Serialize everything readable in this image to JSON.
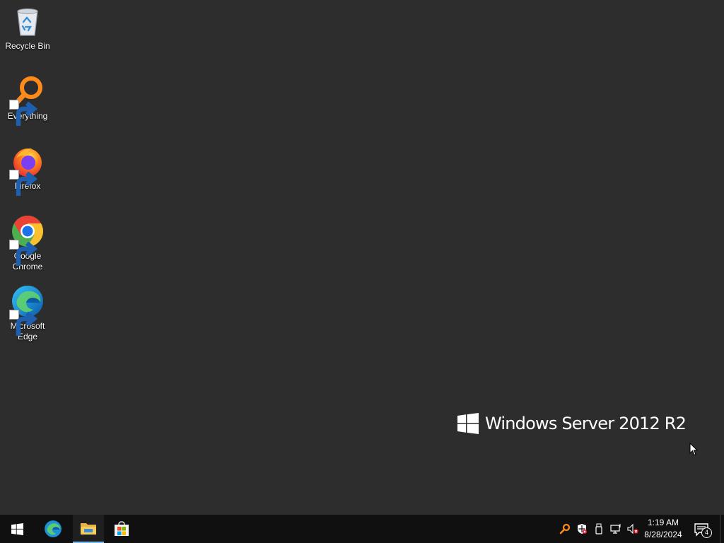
{
  "desktop": {
    "icons": [
      {
        "label": "Recycle Bin",
        "icon": "recycle-bin-icon",
        "shortcut": false
      },
      {
        "label": "Everything",
        "icon": "everything-icon",
        "shortcut": true
      },
      {
        "label": "Firefox",
        "icon": "firefox-icon",
        "shortcut": true
      },
      {
        "label": "Google Chrome",
        "icon": "chrome-icon",
        "shortcut": true
      },
      {
        "label": "Microsoft Edge",
        "icon": "edge-icon",
        "shortcut": true
      }
    ],
    "watermark": "Windows Server 2012 R2"
  },
  "taskbar": {
    "pinned": [
      {
        "name": "start",
        "icon": "windows-logo-icon"
      },
      {
        "name": "edge",
        "icon": "edge-icon"
      },
      {
        "name": "file-explorer",
        "icon": "folder-icon",
        "active": true
      },
      {
        "name": "store",
        "icon": "store-icon"
      }
    ],
    "tray": {
      "icons": [
        "everything-tray-icon",
        "defender-shield-icon",
        "usb-device-icon",
        "network-icon",
        "volume-muted-icon"
      ],
      "time": "1:19 AM",
      "date": "8/28/2024",
      "notification_count": "4"
    }
  },
  "colors": {
    "desktop_bg": "#2d2d2d",
    "taskbar_bg": "#101010",
    "accent": "#76b9ed"
  }
}
